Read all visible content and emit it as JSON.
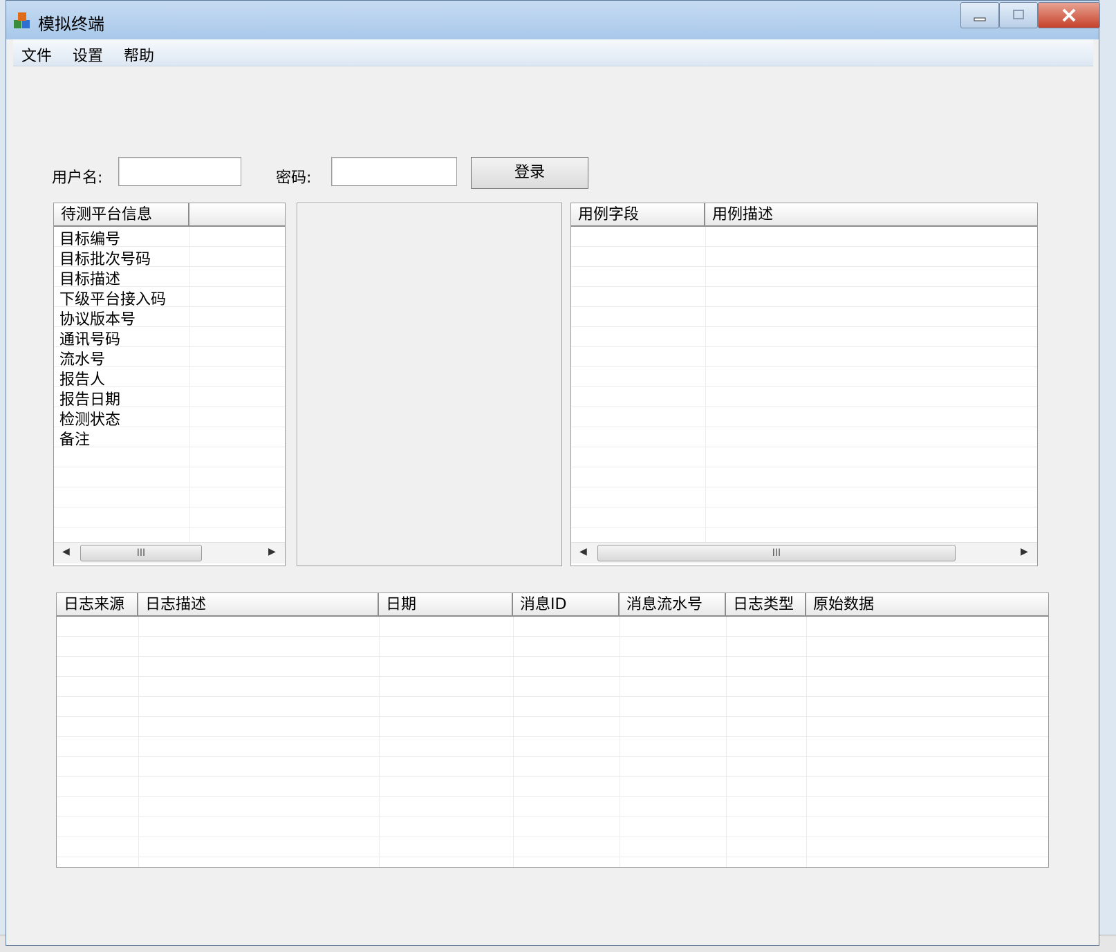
{
  "window": {
    "title": "模拟终端"
  },
  "menu": {
    "items": [
      "文件",
      "设置",
      "帮助"
    ]
  },
  "login": {
    "username_label": "用户名:",
    "password_label": "密码:",
    "login_button": "登录",
    "username_value": "",
    "password_value": ""
  },
  "platform_list": {
    "headers": [
      "待测平台信息",
      ""
    ],
    "items": [
      "目标编号",
      "目标批次号码",
      "目标描述",
      "下级平台接入码",
      "协议版本号",
      "通讯号码",
      "流水号",
      "报告人",
      "报告日期",
      "检测状态",
      "备注"
    ]
  },
  "case_list": {
    "headers": [
      "用例字段",
      "用例描述"
    ]
  },
  "log_list": {
    "headers": [
      "日志来源",
      "日志描述",
      "日期",
      "消息ID",
      "消息流水号",
      "日志类型",
      "原始数据"
    ]
  },
  "scrollbar": {
    "thumb_grip": "III"
  },
  "colors": {
    "close_button": "#c6412a",
    "titlebar": "#a8c8ea"
  }
}
